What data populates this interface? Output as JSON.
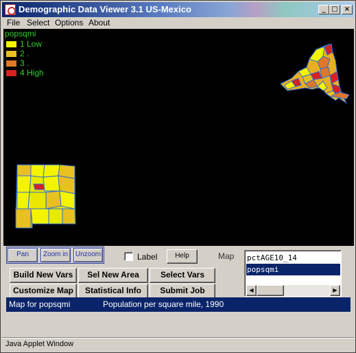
{
  "window": {
    "title": "Demographic Data Viewer 3.1 US-Mexico"
  },
  "menu": [
    "File",
    "Select",
    "Options",
    "About"
  ],
  "legend": {
    "variable": "popsqmi",
    "items": [
      {
        "num": "1",
        "label": "Low",
        "color": "#f4f400"
      },
      {
        "num": "2",
        "label": ".",
        "color": "#e8c020"
      },
      {
        "num": "3",
        "label": ".",
        "color": "#e07828"
      },
      {
        "num": "4",
        "label": "High",
        "color": "#d82020"
      }
    ]
  },
  "toolbar": {
    "pan": "Pan",
    "zoom_in": "Zoom in",
    "unzoom": "Unzoom",
    "label": "Label",
    "help": "Help",
    "map": "Map"
  },
  "buttons": {
    "build_new_vars": "Build New Vars",
    "sel_new_area": "Sel New Area",
    "select_vars": "Select Vars",
    "customize_map": "Customize Map",
    "statistical_info": "Statistical Info",
    "submit_job": "Submit Job"
  },
  "variables": [
    {
      "name": "pctAGE10_14",
      "selected": false
    },
    {
      "name": "popsqmi",
      "selected": true
    }
  ],
  "status": {
    "left": "Map for popsqmi",
    "right": "Population per square mile, 1990"
  },
  "applet_status": "Java Applet Window"
}
